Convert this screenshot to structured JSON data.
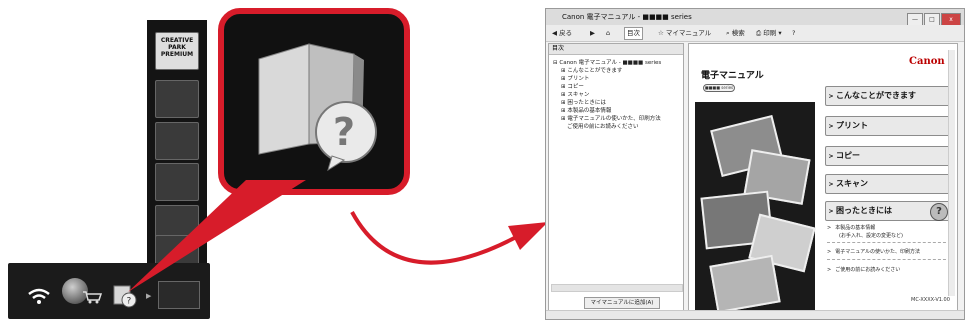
{
  "launcher": {
    "sidebar_selected_label": "CREATIVE PARK PREMIUM",
    "dock_icons": [
      "wifi-icon",
      "globe-icon",
      "cart-icon",
      "manual-help-icon",
      "grid-icon"
    ],
    "sidebar_icons": [
      "creative-park-icon",
      "photo-print-icon",
      "document-print-icon",
      "multi-photo-icon",
      "album-icon",
      "gallery-icon",
      "down-arrow-icon"
    ]
  },
  "callout": {
    "icon": "book-with-question-icon",
    "accent": "#d71c2a"
  },
  "window": {
    "title": "Canon 電子マニュアル - ■■■■ series",
    "buttons": {
      "minimize": "—",
      "maximize": "□",
      "close": "x"
    },
    "toolbar": {
      "back": "◀ 戻る",
      "forward": "▶",
      "home": "⌂",
      "toc": "目次",
      "mymanual": "☆ マイマニュアル",
      "search": "⌕ 検索",
      "print": "⎙ 印刷 ▾",
      "help": "?"
    },
    "toc": {
      "header": "目次",
      "items": [
        "⊟ Canon 電子マニュアル - ■■■■ series",
        "⊞ こんなことができます",
        "⊞ プリント",
        "⊞ コピー",
        "⊞ スキャン",
        "⊞ 困ったときには",
        "⊞ 本製品の基本情報",
        "⊞ 電子マニュアルの使いかた、印刷方法",
        "ご使用の前にお読みください"
      ],
      "add_button": "マイマニュアルに追加(A)"
    },
    "content": {
      "brand": "Canon",
      "title": "電子マニュアル",
      "series_badge": "■■■■ series",
      "nav": [
        "こんなことができます",
        "プリント",
        "コピー",
        "スキャン",
        "困ったときには"
      ],
      "links": [
        "本製品の基本情報",
        "(お手入れ、設定の変更など)",
        "電子マニュアルの使いかた、印刷方法",
        "ご使用の前にお読みください"
      ],
      "version": "MC-XXXX-V1.00"
    }
  },
  "colors": {
    "accent_red": "#d71c2a",
    "canon_red": "#b00000"
  }
}
